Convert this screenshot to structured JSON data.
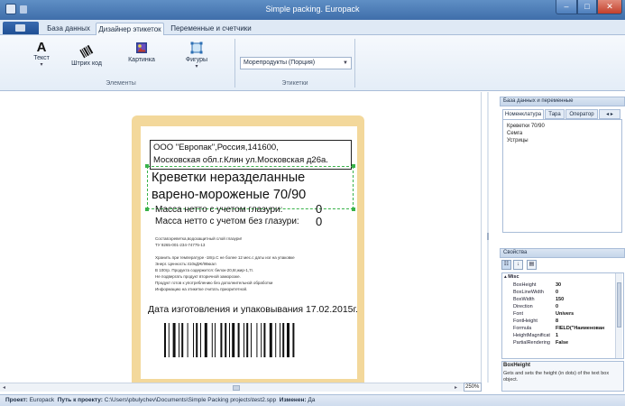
{
  "window": {
    "title": "Simple packing. Europack"
  },
  "ribbon": {
    "tabs": [
      "База данных",
      "Дизайнер этикеток",
      "Переменные и счетчики"
    ],
    "buttons": {
      "text": "Текст",
      "barcode": "Штрих код",
      "picture": "Картинка",
      "shapes": "Фигуры"
    },
    "groups": {
      "elements": "Элементы",
      "labels": "Этикетки"
    },
    "label_combo": "Морепродукты (Порция)"
  },
  "label": {
    "address_line1": "ООО \"Европак\",Россия,141600,",
    "address_line2": "Московская обл.г.Клин ул.Московская д26а.",
    "product_line1": "Креветки неразделанные",
    "product_line2": "варено-мороженые 70/90",
    "mass1": "Масса нетто с учетом глазури:",
    "mass1_value": "0",
    "mass2": "Масса нетто с учетом без глазури:",
    "mass2_value": "0",
    "composition1": "Состав:креветка,водозащитный слой глазури!",
    "composition2": "ТУ 9265-001-234-74775-13",
    "storage": [
      "Хранить при температуре -18гр.С не более 12 мес.с даты изг на упаковке",
      "Энерг. Ценность:410кДЖ/98ккал",
      "В 100гр. Продукта содержится: белок-20,8г,жир-1,7г.",
      "Не подвергать продукт вторичной заморозке.",
      "Продукт готов к употреблению без дополнительной обработки",
      "Информацию на этикетке считать приоритетной."
    ],
    "date_line": "Дата изготовления и упаковывания 17.02.2015г."
  },
  "canvas": {
    "zoom": "250%"
  },
  "db_panel": {
    "header": "База данных и переменные",
    "tabs": [
      "Номенклатура",
      "Тара",
      "Оператор"
    ],
    "items": [
      "Креветки 70/90",
      "Семга",
      "Устрицы"
    ]
  },
  "props_panel": {
    "header": "Свойства",
    "category": "Misc",
    "rows": [
      {
        "name": "BoxHeight",
        "value": "30"
      },
      {
        "name": "BoxLineWidth",
        "value": "0"
      },
      {
        "name": "BoxWidth",
        "value": "150"
      },
      {
        "name": "Direction",
        "value": "0"
      },
      {
        "name": "Font",
        "value": "Univers"
      },
      {
        "name": "FontHeight",
        "value": "8"
      },
      {
        "name": "Formula",
        "value": "FIELD(\"Наименован"
      },
      {
        "name": "HeightMagnificat",
        "value": "1"
      },
      {
        "name": "PartialRendering",
        "value": "False"
      }
    ],
    "desc_title": "BoxHeight",
    "desc_text": "Gets and sets the height (in dots) of the text box object."
  },
  "status": {
    "project_label": "Проект:",
    "project_value": "Europack",
    "path_label": "Путь к проекту:",
    "path_value": "C:\\Users\\pbulychev\\Documents\\Simple Packing projects\\test2.spp",
    "changed_label": "Изменен:",
    "changed_value": "Да"
  }
}
